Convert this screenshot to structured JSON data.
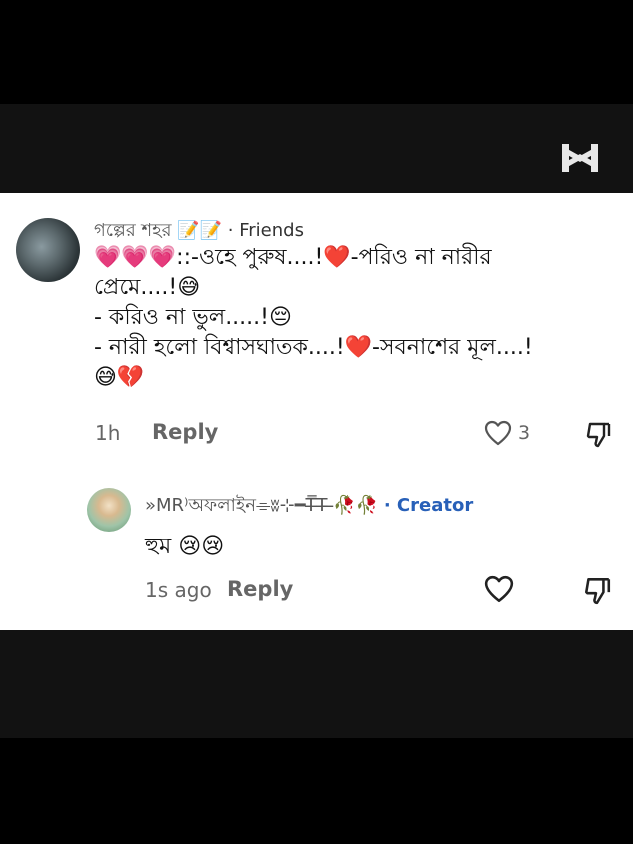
{
  "app": {
    "accent": "#2860b8",
    "icon_names": [
      "capcut-logo-icon",
      "heart-icon",
      "dislike-icon"
    ]
  },
  "comment": {
    "username": "গল্পের শহর 📝📝",
    "badge": "· Friends",
    "lines": [
      "💗💗💗::-ওহে পুরুষ....!❤️-পরিও না নারীর",
      "প্রেমে....!😅",
      "- করিও না ভুল.....!😔",
      "- নারী হলো বিশ্বাসঘাতক....!❤️-সবনাশের মূল....!",
      "😅💔"
    ],
    "time": "1h",
    "reply_label": "Reply",
    "like_count": "3"
  },
  "reply": {
    "username": "»MR⁾অফলাইন⌯ʬ⊹━T̶̅̅T̶ ̶🥀🥀",
    "badge": "· Creator",
    "text": "হুম 😢😢",
    "time": "1s ago",
    "reply_label": "Reply"
  }
}
